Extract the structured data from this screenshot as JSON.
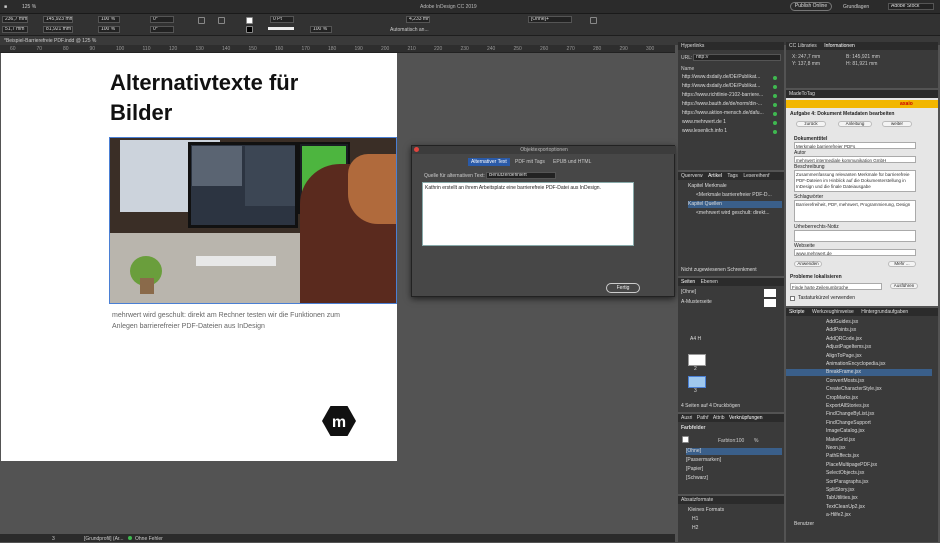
{
  "app": {
    "title": "Adobe InDesign CC 2019",
    "zoom": "125 %",
    "publish": "Publish Online",
    "workspace": "Grundlagen",
    "search_placeholder": "Adobe Stock"
  },
  "doc_tab": "*Beispiel-Barrierefreie PDF.indd @ 125 %",
  "control": {
    "x": "236,7 mm",
    "y": "51,7 mm",
    "w": "145,923 mm",
    "h": "81,921 mm",
    "scale_x": "100 %",
    "scale_y": "100 %",
    "angle": "0°",
    "shear": "0°",
    "stroke": "0 Pt",
    "offset": "4,233 mm",
    "auto": "Automatisch an...",
    "style": "[Ohne]+",
    "pct": "100 %"
  },
  "ruler": [
    "60",
    "70",
    "80",
    "90",
    "100",
    "110",
    "120",
    "130",
    "140",
    "150",
    "160",
    "170",
    "180",
    "190",
    "200",
    "210",
    "220",
    "230",
    "240",
    "250",
    "260",
    "270",
    "280",
    "290",
    "300"
  ],
  "page": {
    "title": "Alternativtexte für Bilder",
    "caption": "mehrwert wird geschult: direkt am Rechner testen wir die Funktionen zum Anlegen barrierefreier PDF-Dateien aus InDesign"
  },
  "dialog": {
    "title": "Objektexportoptionen",
    "tabs": [
      "Alternativer Text",
      "PDF mit Tags",
      "EPUB und HTML"
    ],
    "source_label": "Quelle für alternativen Text:",
    "source_value": "Benutzerdefiniert",
    "text": "Kathrin erstellt an ihrem Arbeitsplatz eine barrierefreie PDF-Datei aus InDesign.",
    "done": "Fertig"
  },
  "hyperlinks": {
    "title": "Hyperlinks",
    "url_label": "URL:",
    "url_value": "http://",
    "name_label": "Name",
    "items": [
      "http://www.dsdaily.de/DE/Publikat...",
      "http://www.dsdaily.de/DE/Publikat...",
      "https://www.richtlinie-2102-barriere...",
      "https://www.bauth.de/de/norm/din-...",
      "https://www.aktion-mensch.de/dafu...",
      "www.mehrwert.de 1",
      "www.lesenlich.info 1"
    ]
  },
  "articles": {
    "tabs": [
      "Querverw",
      "Artikel",
      "Tags",
      "Lesereihenf"
    ],
    "items": [
      "Kapitel Merkmale",
      "<Merkmale barrierefreier PDF-D...",
      "Kapitel Quellen",
      "<mehrwert wird geschult: direkt..."
    ],
    "footer": "Nicht zugewiesenen Schrenkment"
  },
  "pages": {
    "tabs": [
      "Seiten",
      "Ebenen"
    ],
    "none": "[Ohne]",
    "master": "A-Musterseite",
    "spread": "A4 H",
    "page_nums": [
      "2",
      "3"
    ],
    "footer": "4 Seiten auf 4 Druckbögen"
  },
  "swatches": {
    "tabs": [
      "Ausri",
      "Pathf",
      "Attrib",
      "Verknüpfungen"
    ],
    "title": "Farbfelder",
    "tint_label": "Farbton:",
    "tint_value": "100",
    "pct": "%",
    "items": [
      "[Ohne]",
      "[Passermarken]",
      "[Papier]",
      "[Schwarz]"
    ]
  },
  "parastyles": {
    "title": "Absatzformate",
    "items": [
      "Kleines Formats",
      "H1",
      "H2"
    ]
  },
  "info": {
    "tabs": [
      "CC Libraries",
      "Informationen"
    ],
    "x": "X: 247,7 mm",
    "y": "Y: 137,8 mm",
    "w": "B: 145,921 mm",
    "h": "H: 81,921 mm"
  },
  "mehrtag": {
    "title": "MadeToTag",
    "brand": "axaio",
    "task": "Aufgabe 4: Dokument Metadaten bearbeiten",
    "nav": [
      "zurück",
      "Anleitung",
      "weiter"
    ],
    "doc_title_label": "Dokumenttitel",
    "doc_title": "Merkmale barrierefreier PDFs",
    "author_label": "Autor",
    "author": "mehrwert intermediale kommunikation GmbH",
    "desc_label": "Beschreibung",
    "desc": "Zusammenfassung relevanten Merkmale für barrierefreie PDF-Dateien im Hinblick auf die Dokumenterstellung in InDesign und die finale Dateiausgabe",
    "keywords_label": "Schlagwörter",
    "keywords": "Barrierefreiheit, PDF, mehrwert, Programmierung, Design",
    "copyright_label": "Urheberrechts-Notiz",
    "web_label": "Webseite",
    "web": "www.mehrwert.de",
    "apply": "Anwenden",
    "more": "Mehr ...",
    "problems": "Probleme lokalisieren",
    "problem_select": "Finde harte Zeilenumbrüche",
    "run": "Ausführen",
    "shortcut": "Tastaturkürzel verwenden"
  },
  "scripts": {
    "tabs": [
      "Skripte",
      "Werkzeughinweise",
      "Hintergrundaufgaben"
    ],
    "items": [
      "AddGuides.jsx",
      "AddPoints.jsx",
      "AddQRCode.jsx",
      "AdjustPageItems.jsx",
      "AlignToPage.jsx",
      "AnimationEncyclopedia.jsx",
      "BreakFrame.jsx",
      "ConvertMosts.jsx",
      "CreateCharacterStyle.jsx",
      "CropMarks.jsx",
      "ExportAllStories.jsx",
      "FindChangeByList.jsx",
      "FindChangeSupport",
      "ImageCatalog.jsx",
      "MakeGrid.jsx",
      "Neon.jsx",
      "PathEffects.jsx",
      "PlaceMultipagePDF.jsx",
      "SelectObjects.jsx",
      "SortParagraphs.jsx",
      "SplitStory.jsx",
      "TabUtilities.jsx",
      "TextCleanUp2.jsx",
      "a-Hilfe2.jsx"
    ],
    "selected": 6,
    "user_folder": "Benutzer"
  },
  "status": {
    "page": "3",
    "profile": "[Grundprofil] (Ar...",
    "errors": "Ohne Fehler"
  }
}
